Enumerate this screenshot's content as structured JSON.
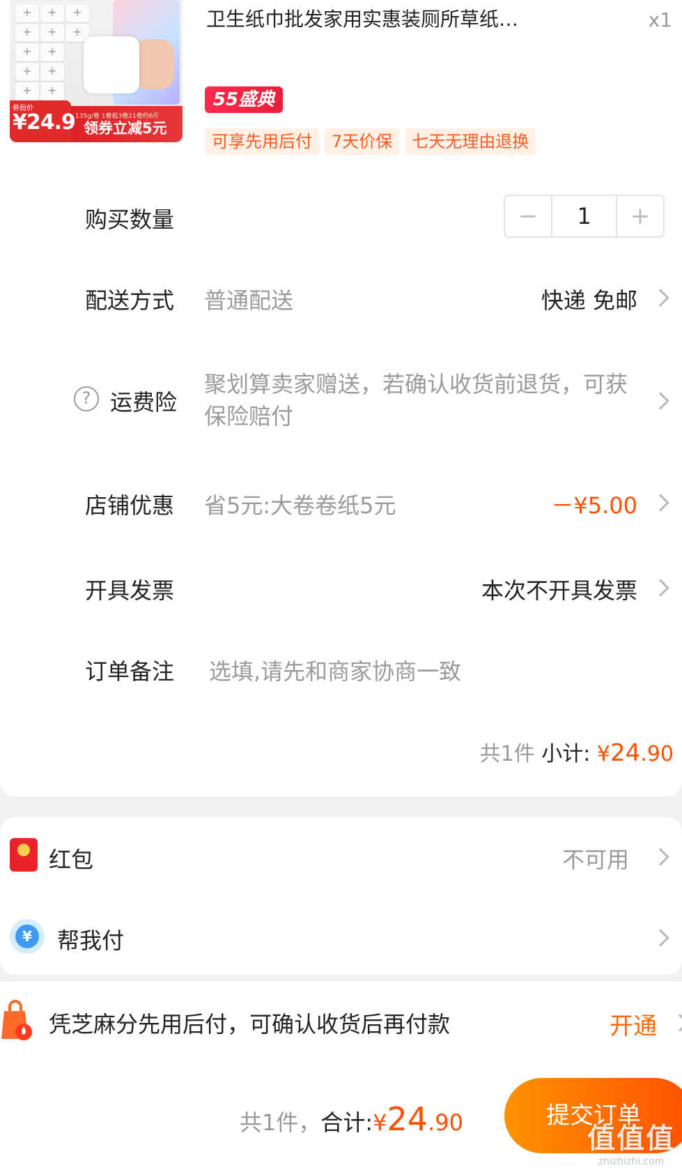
{
  "product": {
    "title": "卫生纸巾批发家用实惠装厕所草纸…",
    "quantity_label": "x1",
    "image": {
      "coupon_tag": "券后价",
      "coupon_price": "¥24.9",
      "spec_text": "135g/卷 1卷抵3卷21卷约6斤",
      "promo_text": "领券立减5元"
    },
    "event_badge": "55盛典",
    "service_tags": [
      "可享先用后付",
      "7天价保",
      "七天无理由退换"
    ]
  },
  "rows": {
    "quantity": {
      "label": "购买数量",
      "value": "1",
      "minus": "−",
      "plus": "+"
    },
    "delivery": {
      "label": "配送方式",
      "sub": "普通配送",
      "value": "快递 免邮"
    },
    "shipping_insurance": {
      "label": "运费险",
      "help": "?",
      "text": "聚划算卖家赠送，若确认收货前退货，可获保险赔付"
    },
    "shop_discount": {
      "label": "店铺优惠",
      "sub": "省5元:大卷卷纸5元",
      "value": "－¥5.00"
    },
    "invoice": {
      "label": "开具发票",
      "value": "本次不开具发票"
    },
    "remark": {
      "label": "订单备注",
      "placeholder": "选填,请先和商家协商一致"
    }
  },
  "subtotal": {
    "count": "共1件",
    "label": "小计:",
    "currency": "¥",
    "integer": "24",
    "decimal": ".90"
  },
  "red_packet": {
    "label": "红包",
    "value": "不可用"
  },
  "help_pay": {
    "label": "帮我付",
    "icon_glyph": "¥"
  },
  "zhima": {
    "text": "凭芝麻分先用后付，可确认收货后再付款",
    "action": "开通"
  },
  "footer": {
    "count": "共1件，",
    "label": "合计:",
    "currency": "¥",
    "integer": "24",
    "decimal": ".90",
    "submit": "提交订单"
  },
  "watermark": {
    "main": "值值值",
    "url": "zhizhizhi.com"
  },
  "colors": {
    "accent": "#ff5000",
    "tag_bg": "#fff1e6",
    "badge": "#ff2a4a"
  }
}
